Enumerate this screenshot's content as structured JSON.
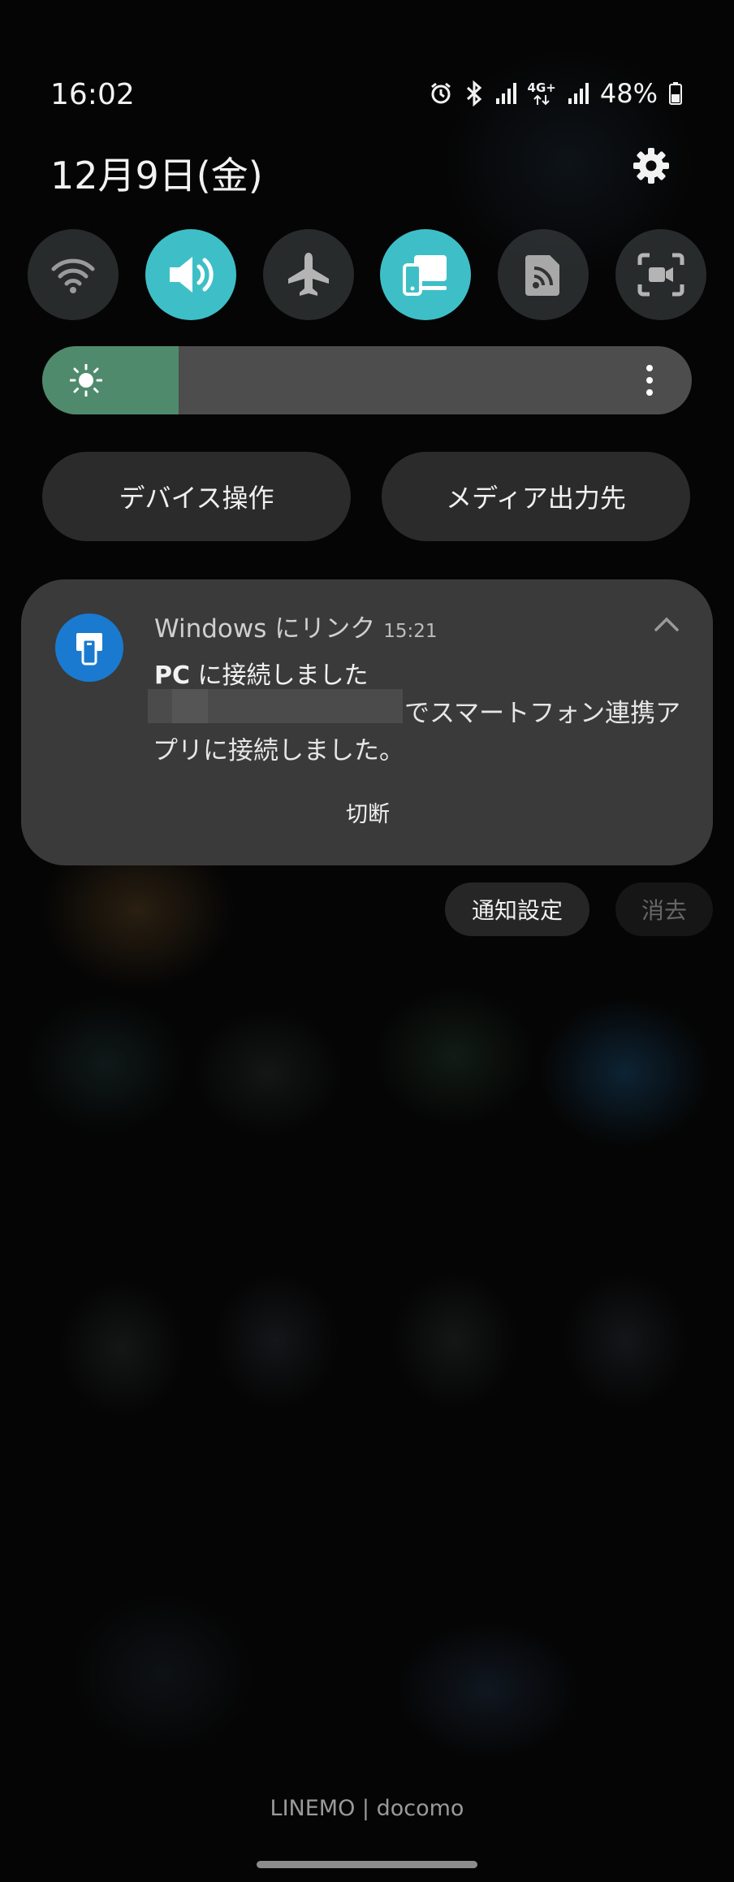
{
  "status_bar": {
    "time": "16:02",
    "network_label": "4G+",
    "battery": "48%",
    "icons": [
      "alarm-icon",
      "bluetooth-icon",
      "signal-icon",
      "4g-plus-data-icon",
      "signal-icon",
      "battery-icon"
    ]
  },
  "header": {
    "date": "12月9日(金)",
    "settings_icon": "gear-icon"
  },
  "quick_settings": {
    "toggles": [
      {
        "icon": "wifi-icon",
        "state": "off"
      },
      {
        "icon": "sound-icon",
        "state": "on"
      },
      {
        "icon": "airplane-icon",
        "state": "off"
      },
      {
        "icon": "link-to-windows-icon",
        "state": "on"
      },
      {
        "icon": "cast-icon",
        "state": "off"
      },
      {
        "icon": "screen-recorder-icon",
        "state": "off"
      }
    ],
    "accent_color": "#3ebfc7",
    "brightness": {
      "level": 0.21,
      "icon": "sun-icon",
      "more_icon": "more-vertical-icon"
    },
    "device_control_label": "デバイス操作",
    "media_output_label": "メディア出力先"
  },
  "notification": {
    "app_name": "Windows にリンク",
    "time": "15:21",
    "title_bold": "PC",
    "title_rest": " に接続しました",
    "body_line1": "でスマートフォン連携ア",
    "body_line2": "プリに接続しました。",
    "action_label": "切断",
    "app_icon_color": "#1a7ad0"
  },
  "notification_controls": {
    "settings_label": "通知設定",
    "clear_label": "消去"
  },
  "footer": {
    "carrier": "LINEMO | docomo"
  }
}
